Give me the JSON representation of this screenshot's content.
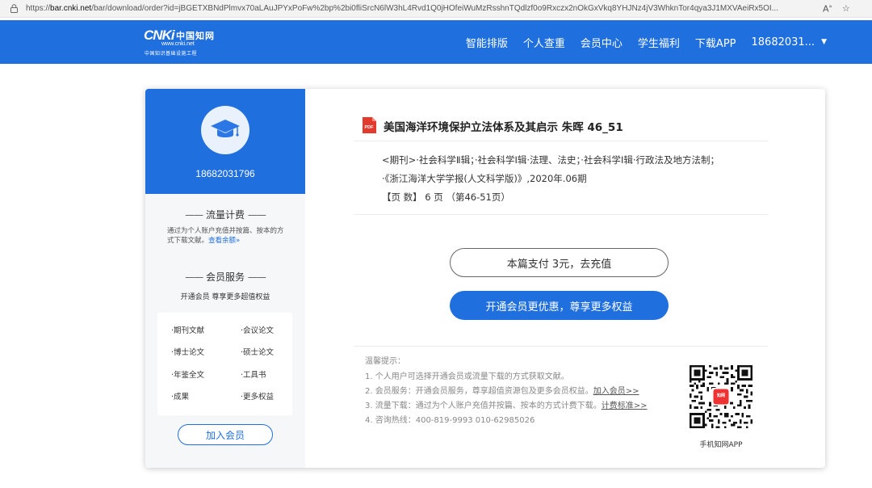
{
  "browser": {
    "url_prefix": "https://",
    "url_host": "bar.cnki.net",
    "url_rest": "/bar/download/order?id=jBGETXBNdPlmvx70aLAuJPYxPoFw%2bp%2bi0fliSrcN6lW3hL4Rvd1Q0jHOfeiWuMzRsshnTQdlzf0o9Rxczx2nOkGxVkq8YHJNz4jV3WhknTor4qya3J1MXVAeiRx5OI...",
    "icons": [
      "lock-icon",
      "read-aloud-icon",
      "favorite-star-icon"
    ]
  },
  "header": {
    "logo": {
      "main": "CNKi",
      "cn": "中国知网",
      "url": "www.cnki.net",
      "sub": "中国知识基础设施工程"
    },
    "nav": [
      "智能排版",
      "个人查重",
      "会员中心",
      "学生福利",
      "下载APP"
    ],
    "user": "18682031...",
    "bg_color": "#1f6fdf"
  },
  "sidebar": {
    "phone": "18682031796",
    "flow_title": "流量计费",
    "flow_desc": "通过为个人账户充值并按篇、按本的方式下载文献。",
    "flow_link": "查看余额»",
    "member_title": "会员服务",
    "member_desc": "开通会员 尊享更多超值权益",
    "services": [
      "·期刊文献",
      "·会议论文",
      "·博士论文",
      "·硕士论文",
      "·年鉴全文",
      "·工具书",
      "·成果",
      "·更多权益"
    ],
    "join_label": "加入会员"
  },
  "document": {
    "title": "美国海洋环境保护立法体系及其启示 朱晖 46_51",
    "category": "<期刊>·社会科学Ⅱ辑；·社会科学Ⅰ辑·法理、法史；·社会科学Ⅰ辑·行政法及地方法制；",
    "journal": "·《浙江海洋大学学报(人文科学版)》,2020年.06期",
    "pages": "【页 数】 6 页 （第46-51页）"
  },
  "actions": {
    "pay_label": "本篇支付 3元，去充值",
    "member_label": "开通会员更优惠，尊享更多权益"
  },
  "tips": {
    "title": "温馨提示：",
    "items": [
      {
        "text": "1. 个人用户可选择开通会员或流量下载的方式获取文献。",
        "link": ""
      },
      {
        "text": "2. 会员服务：开通会员服务，尊享超值资源包及更多会员权益。",
        "link": "加入会员>>"
      },
      {
        "text": "3. 流量下载：通过为个人账户充值并按篇、按本的方式计费下载。",
        "link": "计费标准>>"
      },
      {
        "text": "4. 咨询热线：400-819-9993 010-62985026",
        "link": ""
      }
    ]
  },
  "qr": {
    "label": "手机知网APP",
    "center_text": "知网"
  }
}
